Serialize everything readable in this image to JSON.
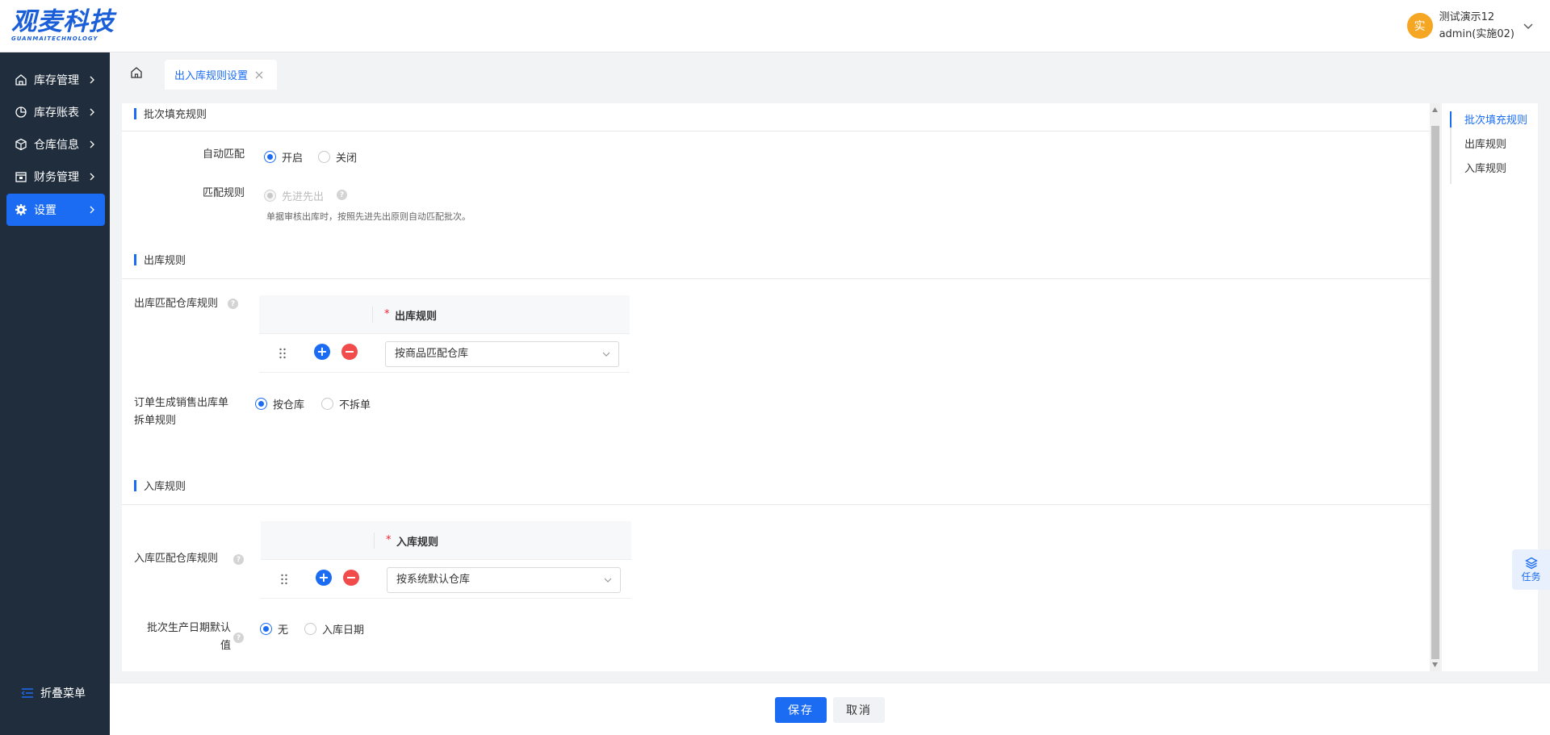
{
  "header": {
    "logo_main": "观麦科技",
    "logo_sub": "GUANMAITECHNOLOGY",
    "avatar_text": "实",
    "user_name": "测试演示12",
    "user_account": "admin(实施02)"
  },
  "sidebar": {
    "items": [
      {
        "label": "库存管理",
        "icon": "home-outline-icon"
      },
      {
        "label": "库存账表",
        "icon": "pie-chart-icon"
      },
      {
        "label": "仓库信息",
        "icon": "cube-icon"
      },
      {
        "label": "财务管理",
        "icon": "wallet-icon"
      },
      {
        "label": "设置",
        "icon": "gear-icon"
      }
    ],
    "active_index": 4,
    "collapse_label": "折叠菜单"
  },
  "tabs": {
    "home_icon": "home-icon",
    "active_tab": "出入库规则设置"
  },
  "batch_section": {
    "title": "批次填充规则",
    "auto_match_label": "自动匹配",
    "auto_match_options": [
      "开启",
      "关闭"
    ],
    "auto_match_selected": "开启",
    "match_rule_label": "匹配规则",
    "match_rule_option": "先进先出",
    "match_rule_hint": "单据审核出库时，按照先进先出原则自动匹配批次。"
  },
  "outbound_section": {
    "title": "出库规则",
    "warehouse_rule_label": "出库匹配仓库规则",
    "table_header": "出库规则",
    "table_required_mark": "*",
    "selected_rule": "按商品匹配仓库",
    "split_rule_label_line1": "订单生成销售出库单",
    "split_rule_label_line2": "拆单规则",
    "split_options": [
      "按仓库",
      "不拆单"
    ],
    "split_selected": "按仓库"
  },
  "inbound_section": {
    "title": "入库规则",
    "warehouse_rule_label": "入库匹配仓库规则",
    "table_header": "入库规则",
    "table_required_mark": "*",
    "selected_rule": "按系统默认仓库",
    "date_default_label_line1": "批次生产日期默认",
    "date_default_label_line2": "值",
    "date_options": [
      "无",
      "入库日期"
    ],
    "date_selected": "无"
  },
  "anchor_nav": {
    "links": [
      "批次填充规则",
      "出库规则",
      "入库规则"
    ],
    "active": "批次填充规则"
  },
  "task_button": {
    "label": "任务",
    "icon": "layers-icon"
  },
  "footer": {
    "save_label": "保存",
    "cancel_label": "取消"
  },
  "colors": {
    "primary": "#1b6cf2",
    "sidebar_bg": "#1f2d3d",
    "danger": "#f24b4b",
    "avatar": "#f5a623"
  }
}
